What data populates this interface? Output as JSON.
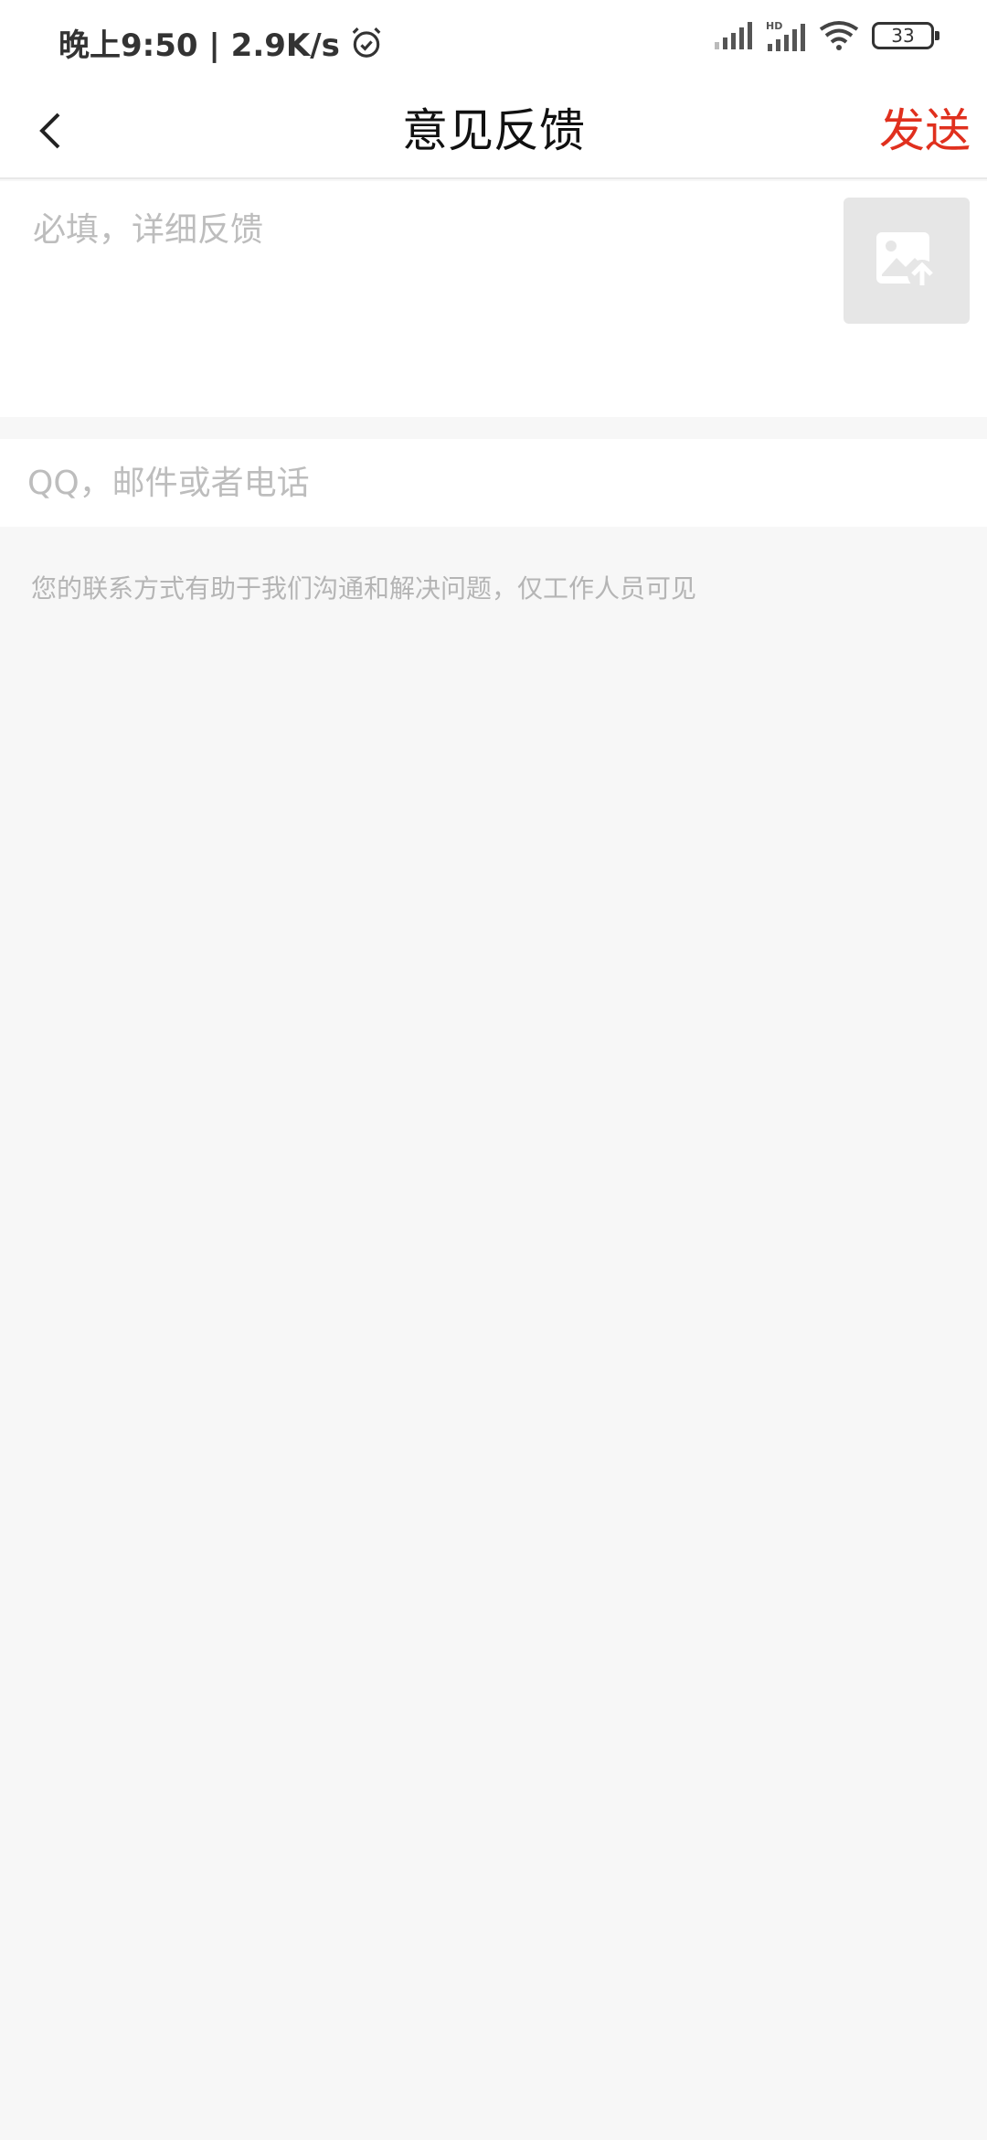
{
  "status_bar": {
    "time_speed": "晚上9:50 | 2.9K/s",
    "battery_level": "33",
    "icons": [
      "alarm-icon",
      "signal-icon",
      "hd-signal-icon",
      "wifi-icon",
      "battery-icon"
    ]
  },
  "header": {
    "title": "意见反馈",
    "send_label": "发送",
    "accent_color": "#e0301e"
  },
  "feedback": {
    "placeholder": "必填，详细反馈",
    "value": ""
  },
  "contact": {
    "placeholder": "QQ，邮件或者电话",
    "value": ""
  },
  "hint": "您的联系方式有助于我们沟通和解决问题，仅工作人员可见"
}
